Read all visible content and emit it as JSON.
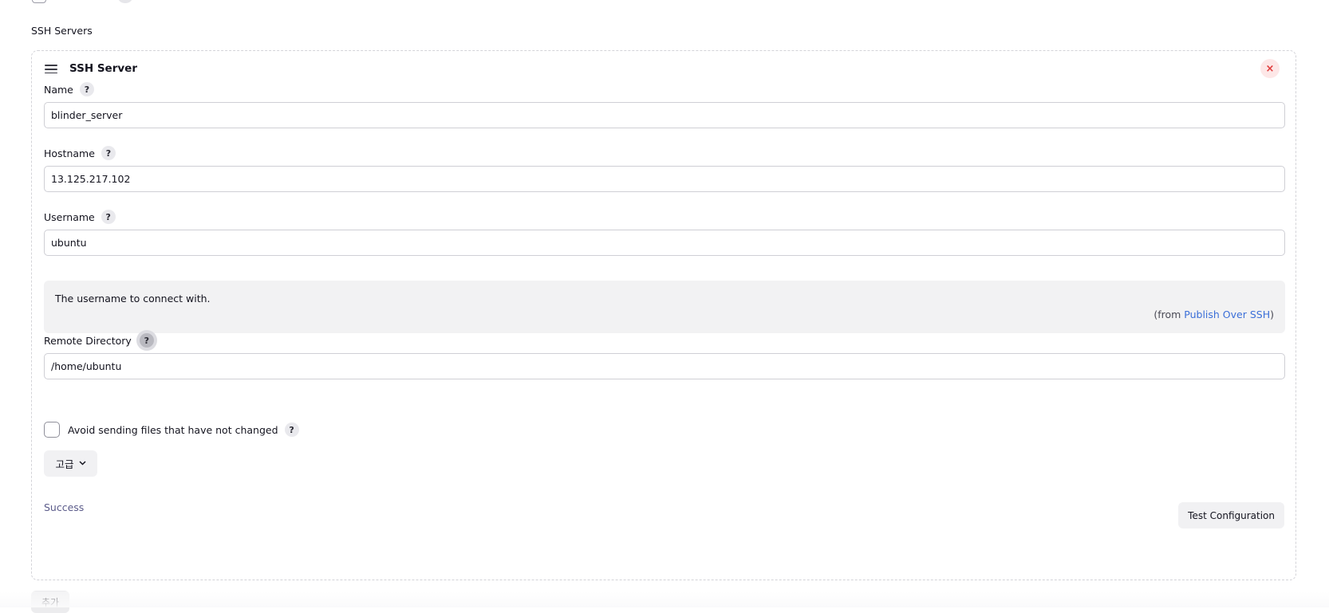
{
  "section": {
    "label": "SSH Servers"
  },
  "server": {
    "title": "SSH Server",
    "close_symbol": "×",
    "fields": {
      "name": {
        "label": "Name",
        "value": "blinder_server"
      },
      "hostname": {
        "label": "Hostname",
        "value": "13.125.217.102"
      },
      "username": {
        "label": "Username",
        "value": "ubuntu"
      },
      "remote_directory": {
        "label": "Remote Directory",
        "value": "/home/ubuntu"
      }
    },
    "help_symbol": "?",
    "username_help": {
      "text": "The username to connect with.",
      "from_prefix": "(from ",
      "from_link": "Publish Over SSH",
      "from_suffix": ")"
    },
    "avoid_unchanged": {
      "label": "Avoid sending files that have not changed",
      "checked": false
    },
    "advanced_label": "고급",
    "status": "Success",
    "test_button": "Test Configuration"
  },
  "add_button": "추가",
  "icons": {
    "drag": "drag-handle-icon",
    "close": "close-icon",
    "help": "help-icon",
    "chevron": "chevron-down-icon"
  },
  "colors": {
    "link": "#3b6fd8",
    "status": "#5b5b8a",
    "close_bg": "#fde7e7",
    "close_fg": "#e03b3b"
  }
}
